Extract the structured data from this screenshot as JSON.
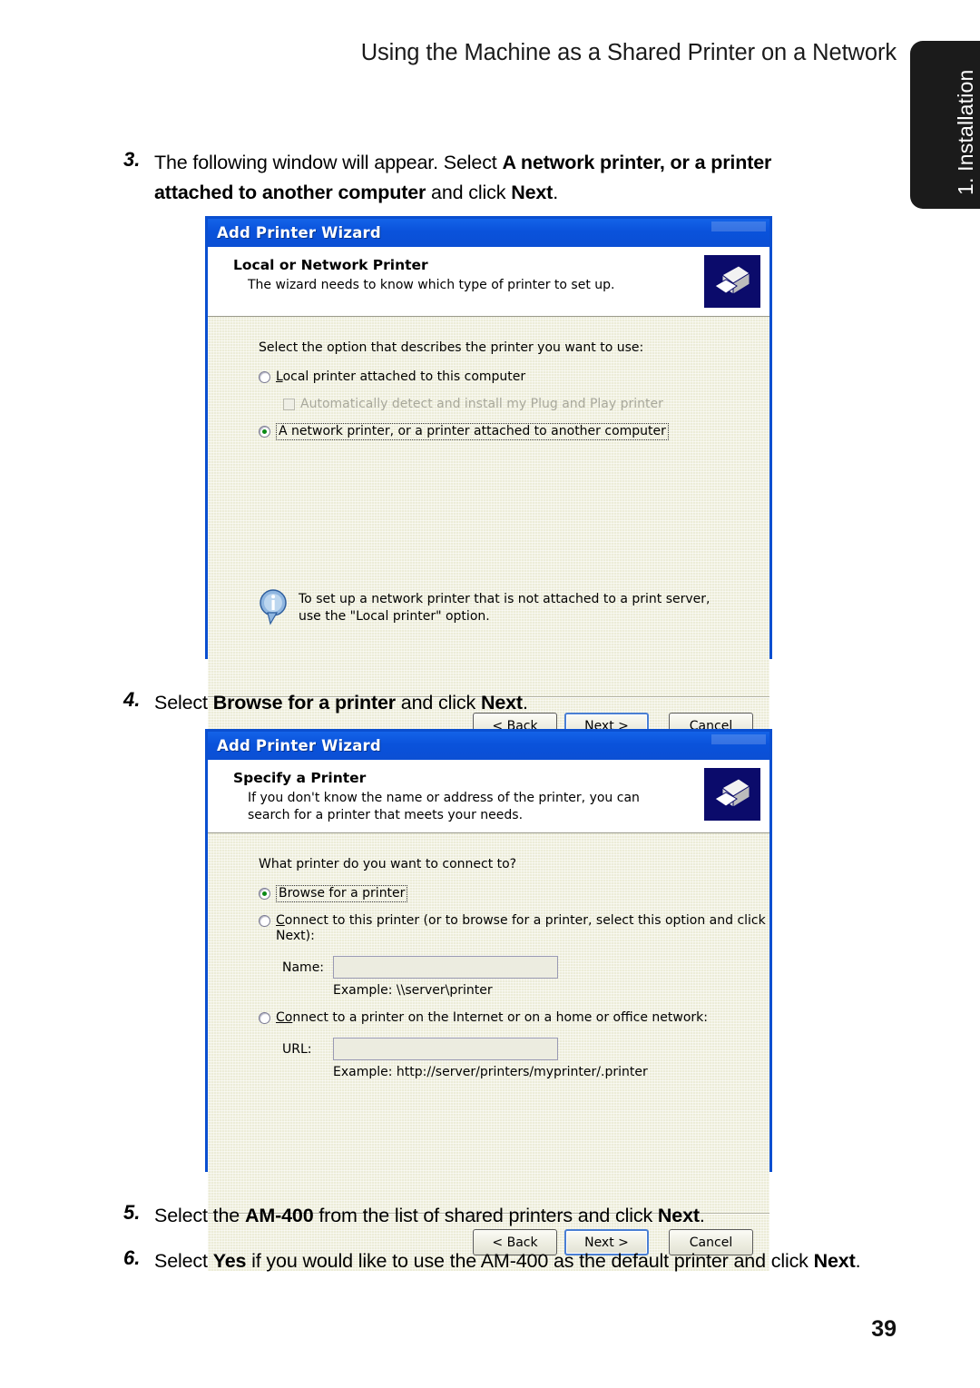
{
  "page": {
    "header_title": "Using the Machine as a Shared Printer on a Network",
    "side_tab_label": "1. Installation",
    "page_number": "39"
  },
  "steps": {
    "step3": {
      "number": "3.",
      "parts": [
        {
          "text": "The following window will appear. Select ",
          "bold": false
        },
        {
          "text": "A network printer, or a printer attached to another computer",
          "bold": true
        },
        {
          "text": " and click ",
          "bold": false
        },
        {
          "text": "Next",
          "bold": true
        },
        {
          "text": ".",
          "bold": false
        }
      ]
    },
    "step4": {
      "number": "4.",
      "parts": [
        {
          "text": "Select ",
          "bold": false
        },
        {
          "text": "Browse for a printer",
          "bold": true
        },
        {
          "text": " and click ",
          "bold": false
        },
        {
          "text": "Next",
          "bold": true
        },
        {
          "text": ".",
          "bold": false
        }
      ]
    },
    "step5": {
      "number": "5.",
      "parts": [
        {
          "text": "Select the ",
          "bold": false
        },
        {
          "text": "AM-400",
          "bold": true
        },
        {
          "text": " from the list of shared printers and click ",
          "bold": false
        },
        {
          "text": "Next",
          "bold": true
        },
        {
          "text": ".",
          "bold": false
        }
      ]
    },
    "step6": {
      "number": "6.",
      "parts": [
        {
          "text": "Select ",
          "bold": false
        },
        {
          "text": "Yes",
          "bold": true
        },
        {
          "text": " if you would like to use the AM-400 as the default printer and click ",
          "bold": false
        },
        {
          "text": "Next",
          "bold": true
        },
        {
          "text": ".",
          "bold": false
        }
      ]
    }
  },
  "dialog1": {
    "title": "Add Printer Wizard",
    "header_title": "Local or Network Printer",
    "header_subtitle": "The wizard needs to know which type of printer to set up.",
    "icon": "printer-icon",
    "prompt": "Select the option that describes the printer you want to use:",
    "options": [
      {
        "label": "Local printer attached to this computer",
        "accel_prefix": "L",
        "accel_rest": "ocal printer attached to this computer",
        "selected": false,
        "type": "radio",
        "disabled": false,
        "focused": false
      },
      {
        "label": "Automatically detect and install my Plug and Play printer",
        "accel_prefix": "A",
        "accel_rest": "utomatically detect and install my Plug and Play printer",
        "selected": false,
        "type": "checkbox",
        "disabled": true,
        "focused": false
      },
      {
        "label": "A network printer, or a printer attached to another computer",
        "accel_prefix": "A n",
        "accel_rest": "etwork printer, or a printer attached to another computer",
        "selected": true,
        "type": "radio",
        "disabled": false,
        "focused": true
      }
    ],
    "info": {
      "icon": "info-icon",
      "line1": "To set up a network printer that is not attached to a print server,",
      "line2": "use the \"Local printer\" option."
    },
    "buttons": {
      "back": "< Back",
      "next": "Next >",
      "cancel": "Cancel"
    }
  },
  "dialog2": {
    "title": "Add Printer Wizard",
    "header_title": "Specify a Printer",
    "header_subtitle": "If you don't know the name or address of the printer, you can search for a printer that meets your needs.",
    "icon": "printer-icon",
    "prompt": "What printer do you want to connect to?",
    "options": [
      {
        "label": "Browse for a printer",
        "accel_prefix": "Bro",
        "accel_rest": "wse for a printer",
        "selected": true,
        "focused": true
      },
      {
        "label": "Connect to this printer (or to browse for a printer, select this option and click Next):",
        "accel_prefix": "C",
        "accel_rest": "onnect to this printer (or to browse for a printer, select this option and click Next):",
        "selected": false,
        "focused": false
      },
      {
        "label": "Connect to a printer on the Internet or on a home or office network:",
        "accel_prefix": "Co",
        "accel_rest": "nnect to a printer on the Internet or on a home or office network:",
        "selected": false,
        "focused": false
      }
    ],
    "name_field": {
      "label": "Name:",
      "value": "",
      "placeholder": "",
      "example": "Example: \\\\server\\printer"
    },
    "url_field": {
      "label": "URL:",
      "value": "",
      "placeholder": "",
      "example": "Example: http://server/printers/myprinter/.printer"
    },
    "buttons": {
      "back": "< Back",
      "next": "Next >",
      "cancel": "Cancel"
    }
  },
  "colors": {
    "titlebar_blue": "#0A52DB",
    "dialog_border": "#0A4FD0",
    "dialog_body": "#ECECD8",
    "radio_dot_green": "#0A8A15",
    "side_tab_black": "#1B1B1B"
  }
}
